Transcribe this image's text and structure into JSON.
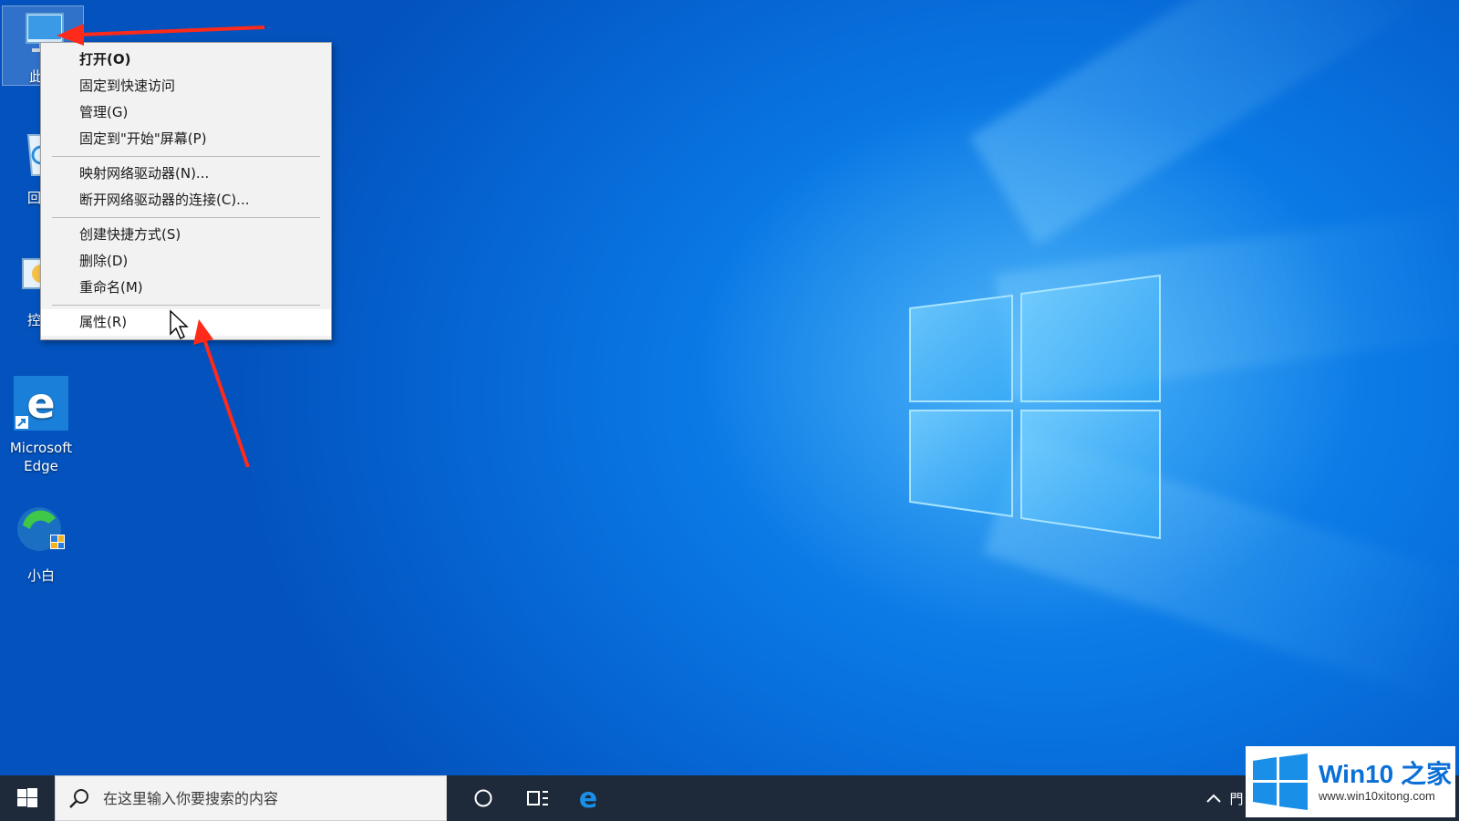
{
  "desktop": {
    "icons": [
      {
        "label": "此电",
        "icon": "this-pc-icon"
      },
      {
        "label": "回收",
        "icon": "recycle-bin-icon"
      },
      {
        "label": "控制",
        "icon": "control-panel-icon"
      },
      {
        "label": "Microsoft Edge",
        "icon": "edge-icon"
      },
      {
        "label": "小白",
        "icon": "xiaobai-icon"
      }
    ]
  },
  "context_menu": {
    "items": [
      {
        "label": "打开(O)"
      },
      {
        "label": "固定到快速访问"
      },
      {
        "label": "管理(G)"
      },
      {
        "label": "固定到\"开始\"屏幕(P)"
      },
      {
        "label": "映射网络驱动器(N)..."
      },
      {
        "label": "断开网络驱动器的连接(C)..."
      },
      {
        "label": "创建快捷方式(S)"
      },
      {
        "label": "删除(D)"
      },
      {
        "label": "重命名(M)"
      },
      {
        "label": "属性(R)"
      }
    ]
  },
  "taskbar": {
    "search_placeholder": "在这里输入你要搜索的内容",
    "tray_partial": "門"
  },
  "watermark": {
    "title": "Win10 之家",
    "url": "www.win10xitong.com"
  },
  "colors": {
    "annotation_arrow": "#ff2a1a",
    "taskbar_bg": "#1e2a3a",
    "edge_blue": "#1a7fd8"
  }
}
